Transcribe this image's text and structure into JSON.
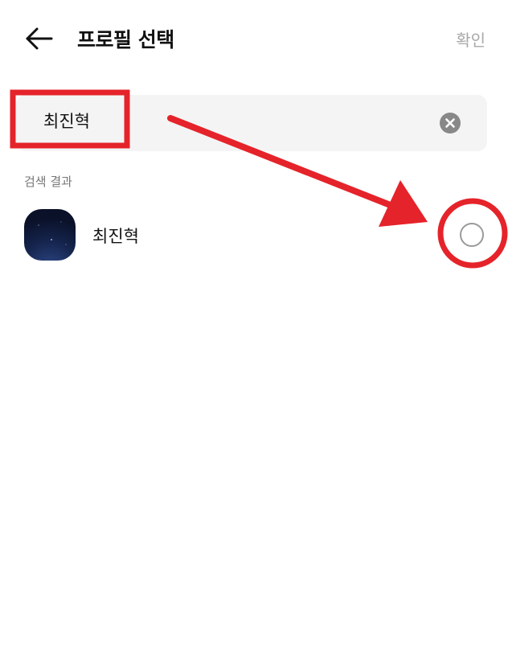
{
  "header": {
    "title": "프로필 선택",
    "confirm_label": "확인"
  },
  "search": {
    "value": "최진혁"
  },
  "results": {
    "section_label": "검색 결과",
    "items": [
      {
        "name": "최진혁",
        "selected": false
      }
    ]
  },
  "annotation": {
    "color": "#e5232a"
  },
  "icons": {
    "back": "arrow-left-icon",
    "clear": "close-circle-icon",
    "radio": "radio-unchecked-icon"
  }
}
